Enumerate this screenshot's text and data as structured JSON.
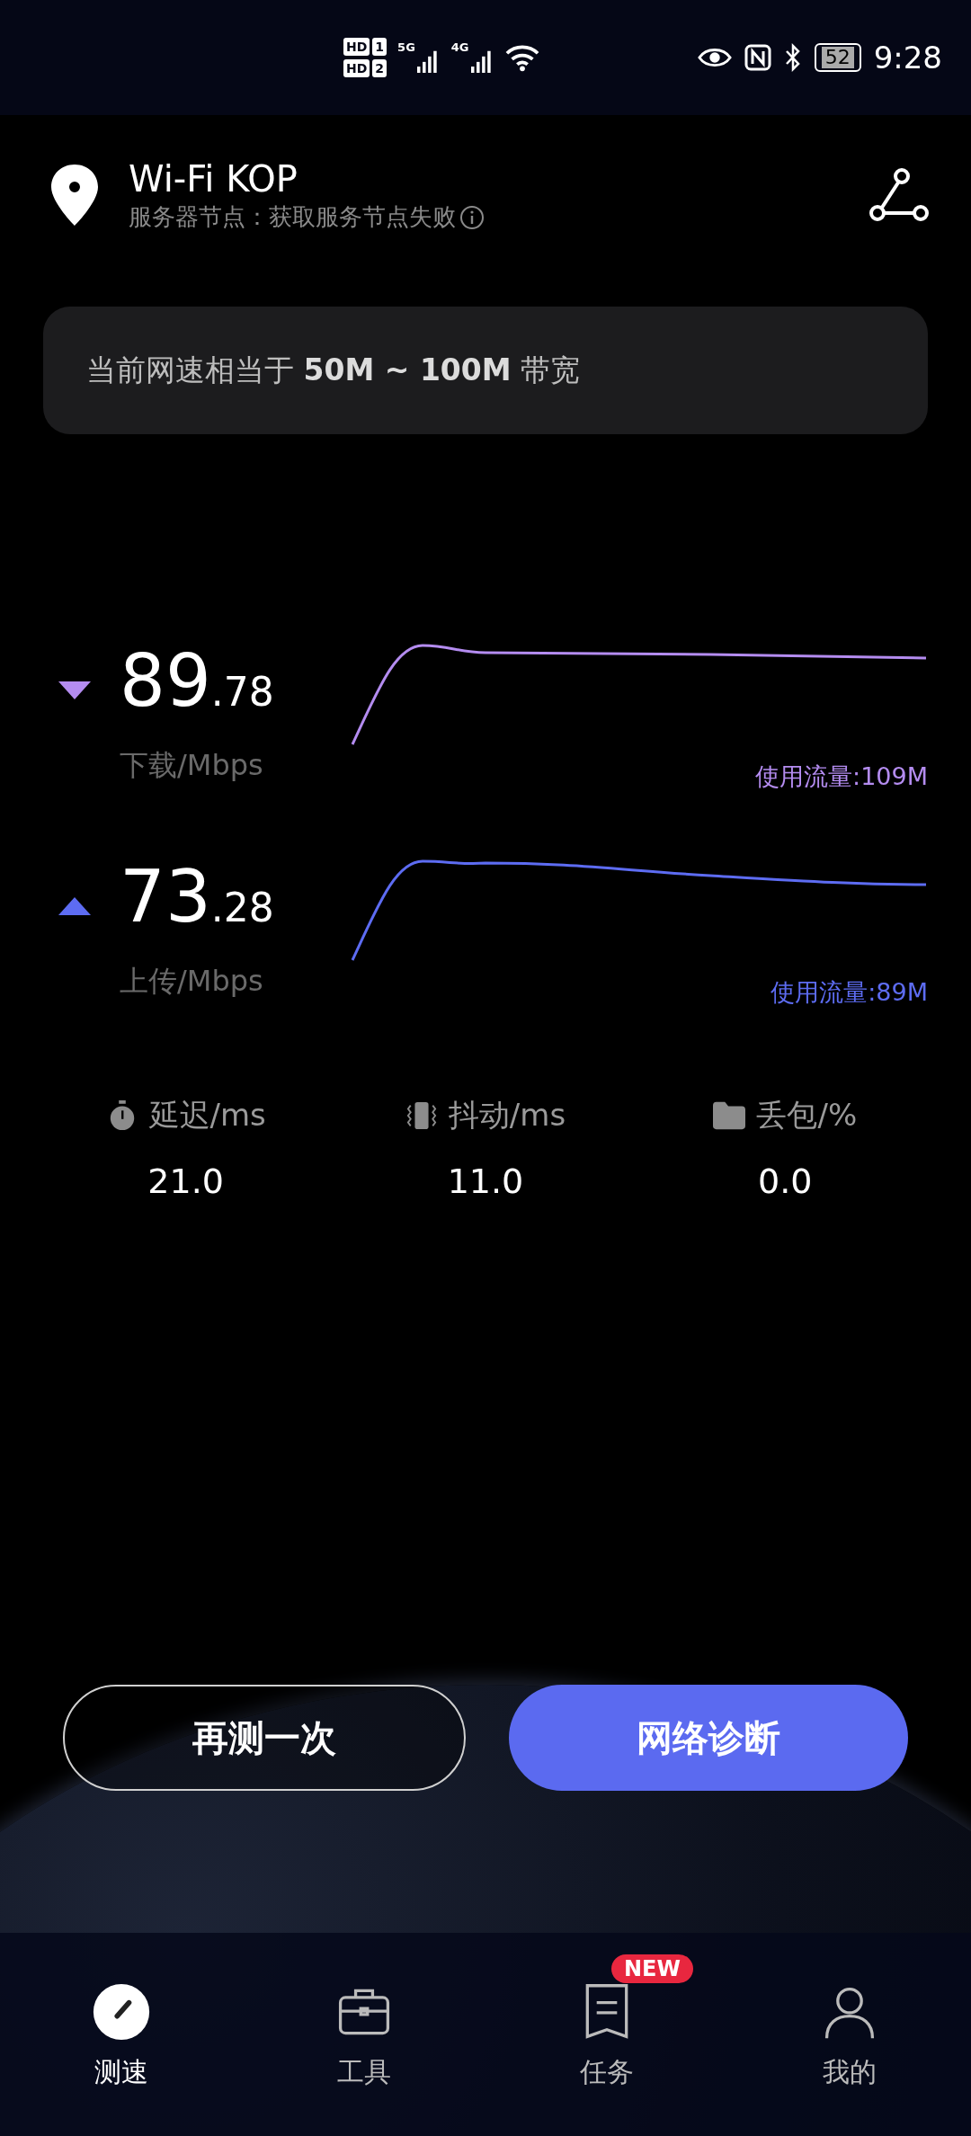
{
  "status_bar": {
    "sim_labels": [
      {
        "text": "HD",
        "slot": "1"
      },
      {
        "text": "HD",
        "slot": "2"
      }
    ],
    "networks": [
      "5G",
      "4G"
    ],
    "battery": "52",
    "time": "9:28"
  },
  "header": {
    "title": "Wi-Fi KOP",
    "subtitle": "服务器节点：获取服务节点失败"
  },
  "bandwidth": {
    "text": "当前网速相当于 **50M ~ 100M** 带宽"
  },
  "speeds": [
    {
      "kind": "download",
      "integer": "89",
      "decimal": ".78",
      "label": "下载/Mbps",
      "usage": "使用流量:109M",
      "color": "#b48cf0"
    },
    {
      "kind": "upload",
      "integer": "73",
      "decimal": ".28",
      "label": "上传/Mbps",
      "usage": "使用流量:89M",
      "color": "#5d6cf2"
    }
  ],
  "metrics": [
    {
      "kind": "latency",
      "label": "延迟/ms",
      "value": "21.0"
    },
    {
      "kind": "jitter",
      "label": "抖动/ms",
      "value": "11.0"
    },
    {
      "kind": "loss",
      "label": "丢包/%",
      "value": "0.0"
    }
  ],
  "buttons": [
    {
      "kind": "outline",
      "label": "再测一次"
    },
    {
      "kind": "primary",
      "label": "网络诊断"
    }
  ],
  "nav": [
    {
      "kind": "speed",
      "label": "测速",
      "selected": true
    },
    {
      "kind": "tools",
      "label": "工具",
      "selected": false
    },
    {
      "kind": "tasks",
      "label": "任务",
      "selected": false,
      "badge": "NEW"
    },
    {
      "kind": "me",
      "label": "我的",
      "selected": false
    }
  ]
}
